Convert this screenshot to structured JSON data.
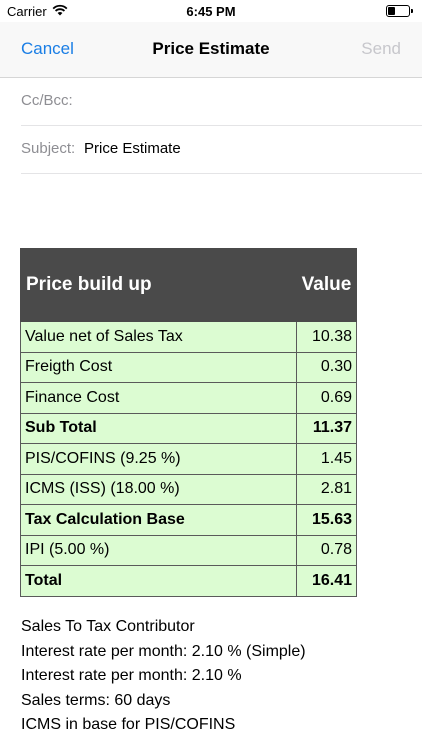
{
  "status_bar": {
    "carrier": "Carrier",
    "time": "6:45 PM",
    "battery_level": 0.35
  },
  "nav": {
    "cancel": "Cancel",
    "title": "Price Estimate",
    "send": "Send"
  },
  "fields": {
    "cc_label": "Cc/Bcc:",
    "subject_label": "Subject:",
    "subject_value": "Price Estimate"
  },
  "table": {
    "headers": [
      "Price build up",
      "Value"
    ],
    "rows": [
      {
        "label": "Value net of Sales Tax",
        "value": "10.38",
        "bold": false
      },
      {
        "label": "Freigth Cost",
        "value": "0.30",
        "bold": false
      },
      {
        "label": "Finance Cost",
        "value": "0.69",
        "bold": false
      },
      {
        "label": "Sub Total",
        "value": "11.37",
        "bold": true
      },
      {
        "label": "PIS/COFINS (9.25 %)",
        "value": "1.45",
        "bold": false
      },
      {
        "label": "ICMS (ISS) (18.00 %)",
        "value": "2.81",
        "bold": false
      },
      {
        "label": "Tax Calculation Base",
        "value": "15.63",
        "bold": true
      },
      {
        "label": "IPI (5.00 %)",
        "value": "0.78",
        "bold": false
      },
      {
        "label": "Total",
        "value": "16.41",
        "bold": true
      }
    ]
  },
  "notes": [
    "Sales To Tax Contributor",
    "Interest rate per month: 2.10 % (Simple)",
    "Interest rate per month: 2.10 %",
    "Sales terms: 60 days",
    "ICMS in base for PIS/COFINS"
  ]
}
